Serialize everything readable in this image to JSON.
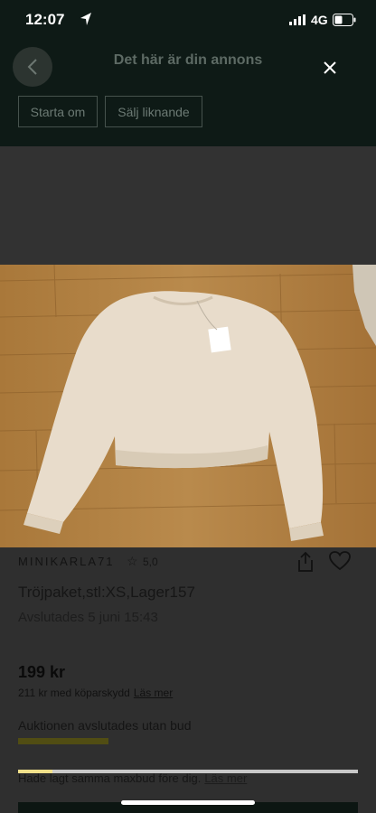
{
  "status_bar": {
    "time": "12:07",
    "network": "4G"
  },
  "header": {
    "title": "Det här är din annons",
    "back_icon": "chevron-left-icon",
    "close_icon": "close-icon",
    "restart_label": "Starta om",
    "sell_similar_label": "Sälj liknande"
  },
  "listing": {
    "seller": "MINIKARLA71",
    "rating": "5,0",
    "title": "Tröjpaket,stl:XS,Lager157",
    "ends": "Avslutades 5 juni 15:43",
    "price": "199 kr",
    "buyer_protection": "211 kr med köparskydd",
    "read_more": "Läs mer",
    "auction_status": "Auktionen avslutades utan bud",
    "bid_note": "Hade lagt samma maxbud före dig.",
    "bid_note_link": "Läs mer",
    "progress": 0.1
  },
  "colors": {
    "header_bg": "#0e1a16",
    "overlay_bg": "#2f2f2f",
    "accent_yellow": "#f0e08a"
  }
}
